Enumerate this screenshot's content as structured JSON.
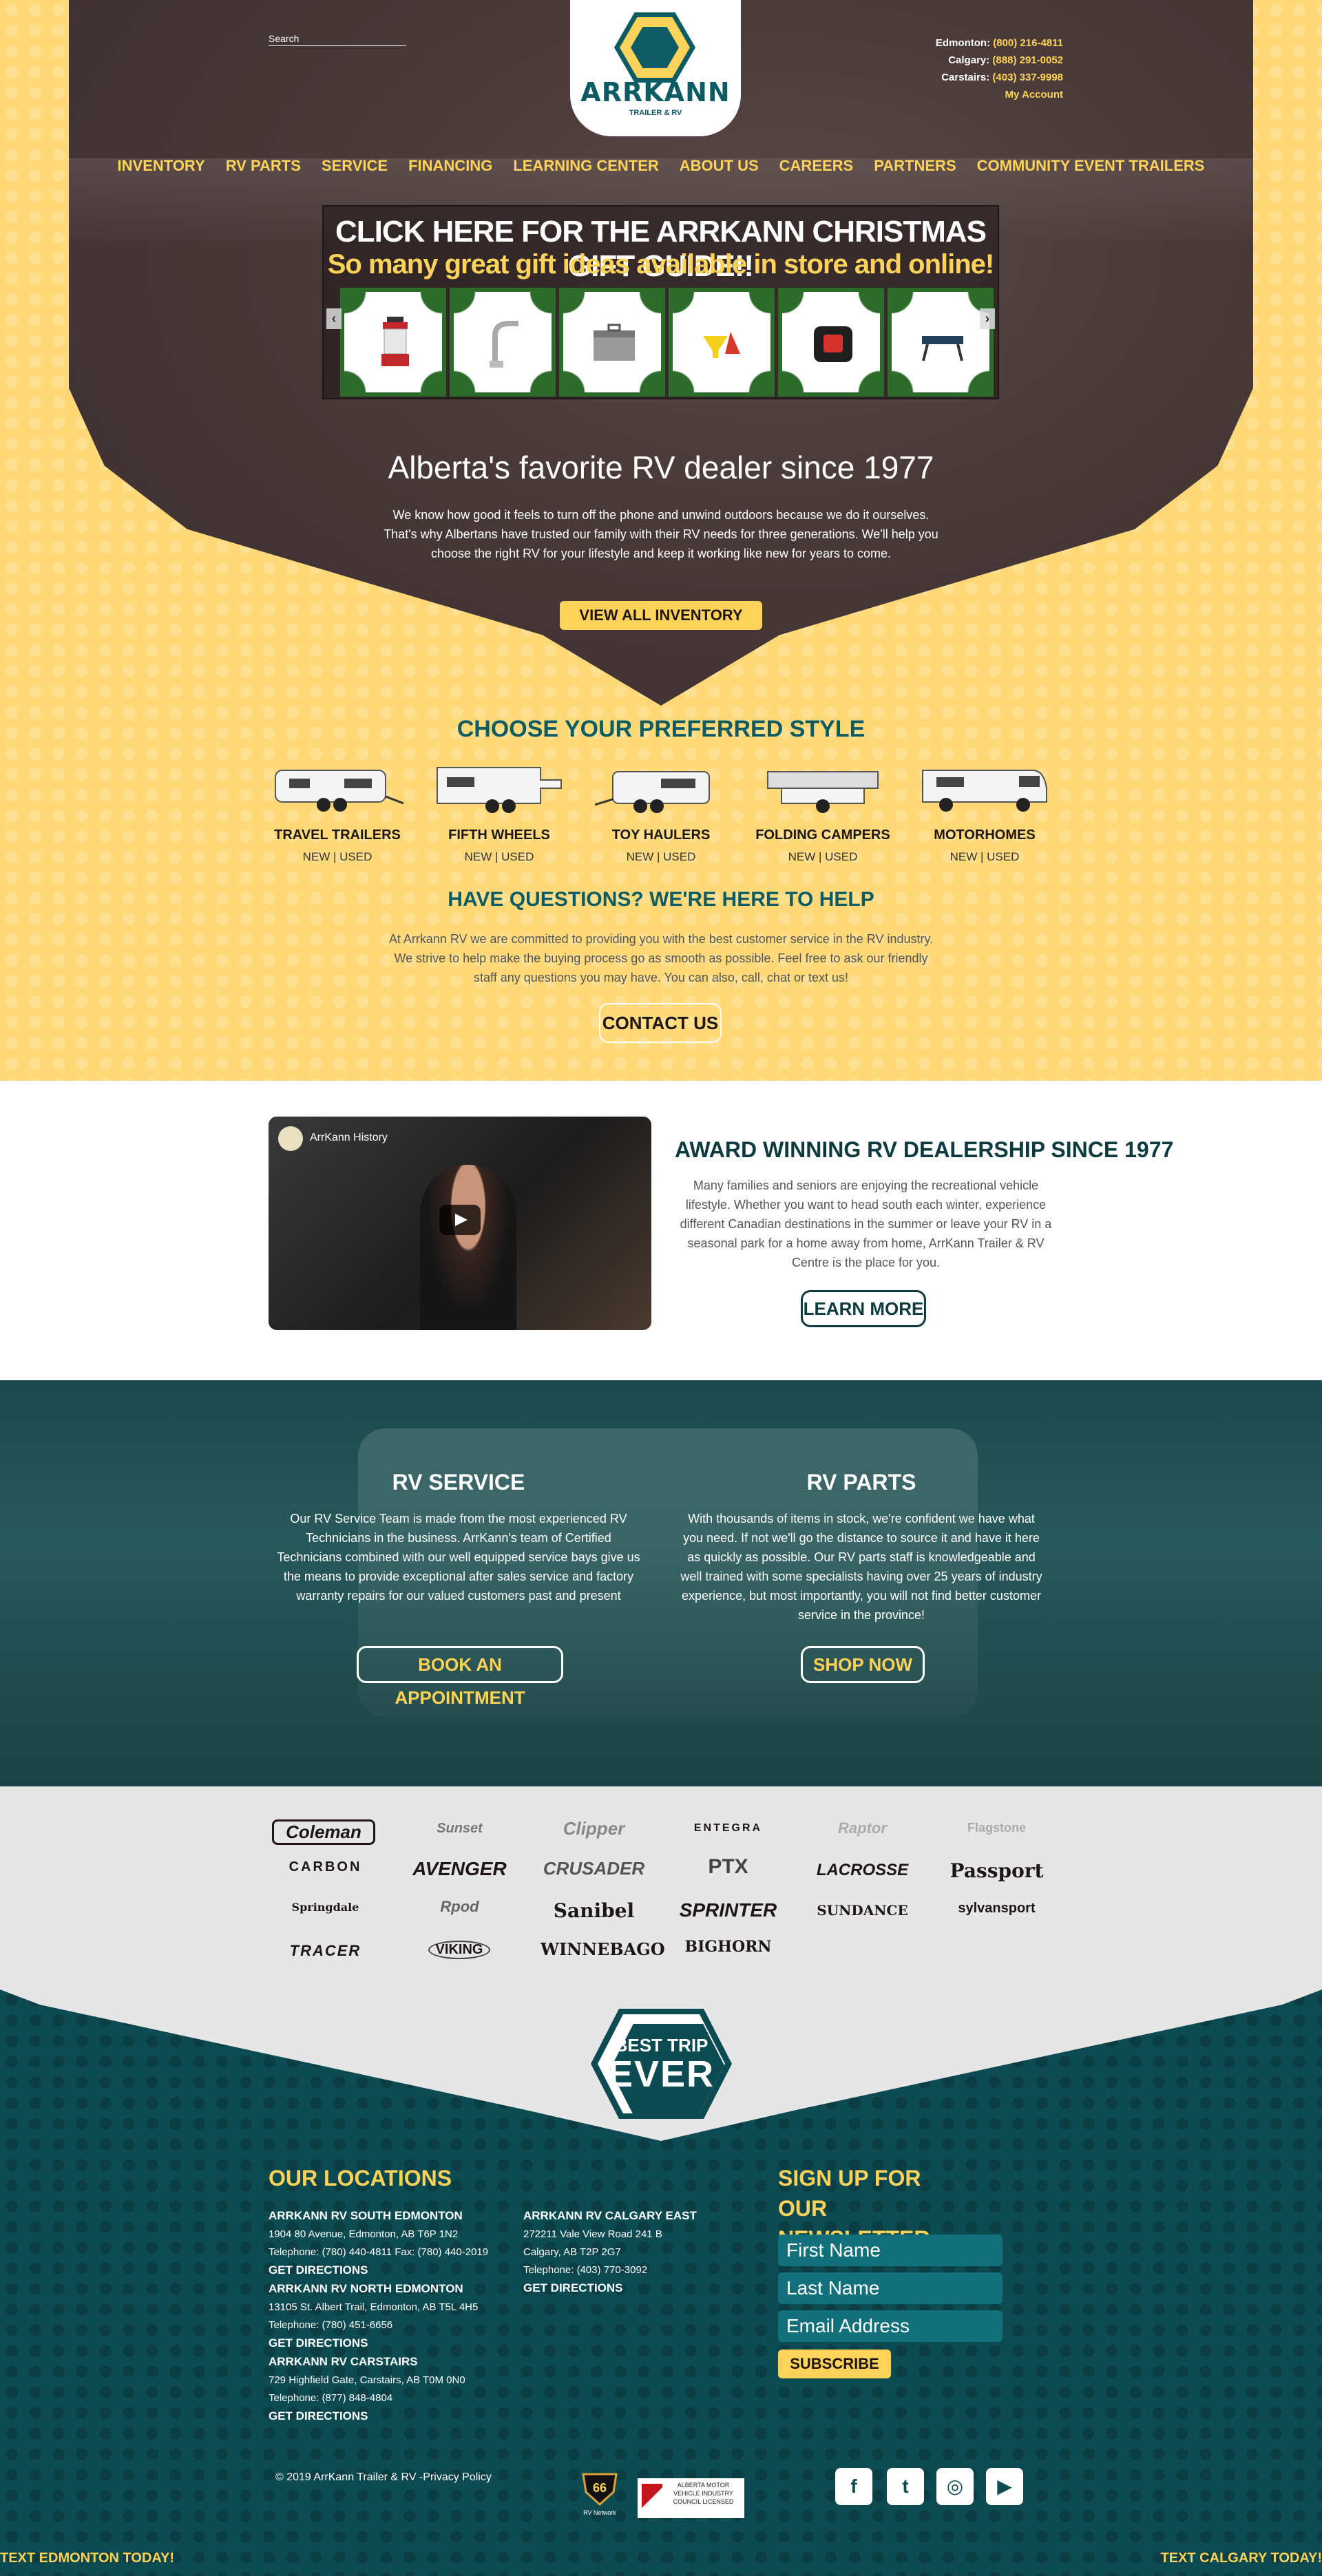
{
  "header": {
    "search_placeholder": "Search",
    "logo_name": "ARRKANN",
    "logo_sub": "TRAILER & RV",
    "contacts": [
      {
        "label": "Edmonton:",
        "phone": "(800) 216-4811"
      },
      {
        "label": "Calgary:",
        "phone": "(888) 291-0052"
      },
      {
        "label": "Carstairs:",
        "phone": "(403) 337-9998"
      }
    ],
    "my_account": "My Account"
  },
  "nav": [
    "INVENTORY",
    "RV PARTS",
    "SERVICE",
    "FINANCING",
    "LEARNING CENTER",
    "ABOUT US",
    "CAREERS",
    "PARTNERS",
    "COMMUNITY EVENT TRAILERS"
  ],
  "promo": {
    "title": "CLICK HERE FOR THE ARRKANN CHRISTMAS GIFT GUIDE!!",
    "subtitle": "So many great gift ideas available in store and online!",
    "products": [
      "lantern-icon",
      "faucet-icon",
      "toolbox-icon",
      "funnel-icon",
      "generator-icon",
      "step-stool-icon"
    ]
  },
  "hero": {
    "headline": "Alberta's favorite RV dealer since 1977",
    "intro": "We know how good it feels to turn off the phone and unwind outdoors because we do it ourselves. That's why Albertans have trusted our family with their RV needs for three generations. We'll help you choose the right RV for your lifestyle and keep it working like new for years to come.",
    "cta": "VIEW ALL INVENTORY"
  },
  "styles": {
    "title": "CHOOSE YOUR PREFERRED STYLE",
    "items": [
      {
        "name": "TRAVEL TRAILERS",
        "links": "NEW | USED"
      },
      {
        "name": "FIFTH WHEELS",
        "links": "NEW | USED"
      },
      {
        "name": "TOY HAULERS",
        "links": "NEW | USED"
      },
      {
        "name": "FOLDING CAMPERS",
        "links": "NEW | USED"
      },
      {
        "name": "MOTORHOMES",
        "links": "NEW | USED"
      }
    ]
  },
  "questions": {
    "title": "HAVE QUESTIONS? WE'RE HERE TO HELP",
    "text": "At Arrkann RV we are committed to providing you with the best customer service in the RV industry. We strive to help make the buying process go as smooth as possible. Feel free to ask our friendly staff any questions you may have. You can also, call, chat or text us!",
    "cta": "CONTACT US"
  },
  "award": {
    "video_title": "ArrKann History",
    "title": "AWARD WINNING RV DEALERSHIP SINCE 1977",
    "text": "Many families and seniors are enjoying the recreational vehicle lifestyle. Whether you want to head south each winter, experience different Canadian destinations in the summer or leave your RV in a seasonal park for a home away from home, ArrKann Trailer & RV Centre is the place for you.",
    "cta": "LEARN MORE"
  },
  "service": {
    "title": "RV SERVICE",
    "text": "Our RV Service Team is made from the most experienced RV Technicians in the business. ArrKann's team of Certified Technicians combined with our well equipped service bays give us the means to provide exceptional after sales service and factory warranty repairs for our valued customers past and present",
    "cta": "BOOK AN APPOINTMENT"
  },
  "parts": {
    "title": "RV PARTS",
    "text": "With thousands of items in stock, we're confident we have what you need. If not we'll go the distance to source it and have it here as quickly as possible. Our RV parts staff is knowledgeable and well trained with some specialists having over 25 years of industry experience, but most importantly, you will not find better customer service in the province!",
    "cta": "SHOP NOW"
  },
  "brands": [
    "Coleman",
    "Sunset",
    "Clipper",
    "ENTEGRA",
    "Raptor",
    "Flagstone",
    "CARBON",
    "AVENGER",
    "CRUSADER",
    "PTX",
    "LACROSSE",
    "Passport",
    "Springdale",
    "Rpod",
    "Sanibel",
    "SPRINTER",
    "SUNDANCE",
    "sylvansport",
    "TRACER",
    "VIKING",
    "WINNEBAGO",
    "BIGHORN"
  ],
  "footer": {
    "badge_t1": "BEST TRIP",
    "badge_t2": "EVER",
    "locations_title": "OUR LOCATIONS",
    "locations": [
      {
        "name": "ARRKANN RV SOUTH EDMONTON",
        "address": "1904 80 Avenue, Edmonton, AB T6P 1N2",
        "phone": "Telephone: (780) 440-4811 Fax: (780) 440-2019",
        "link": "GET DIRECTIONS"
      },
      {
        "name": "ARRKANN RV NORTH EDMONTON",
        "address": "13105 St. Albert Trail, Edmonton, AB T5L 4H5",
        "phone": "Telephone: (780) 451-6656",
        "link": "GET DIRECTIONS"
      },
      {
        "name": "ARRKANN RV CARSTAIRS",
        "address": "729 Highfield Gate, Carstairs, AB T0M 0N0",
        "phone": "Telephone: (877) 848-4804",
        "link": "GET DIRECTIONS"
      },
      {
        "name": "ARRKANN RV CALGARY EAST",
        "address": "272211 Vale View Road 241 B",
        "address2": "Calgary, AB T2P 2G7",
        "phone": "Telephone: (403) 770-3092",
        "link": "GET DIRECTIONS"
      }
    ],
    "newsletter_title": "SIGN UP FOR OUR NEWSLETTER",
    "first_name": "First Name",
    "last_name": "Last Name",
    "email": "Email Address",
    "subscribe": "SUBSCRIBE",
    "copyright": "© 2019 ArrKann Trailer & RV -",
    "privacy": "Privacy Policy",
    "text_edmonton": "TEXT EDMONTON TODAY!",
    "text_calgary": "TEXT CALGARY TODAY!",
    "amvic": "ALBERTA MOTOR VEHICLE INDUSTRY COUNCIL LICENSED",
    "route": "RV Network"
  },
  "colors": {
    "brand": "#0d5c64",
    "accent": "#ffd35a",
    "hero": "#4a3a3a"
  }
}
